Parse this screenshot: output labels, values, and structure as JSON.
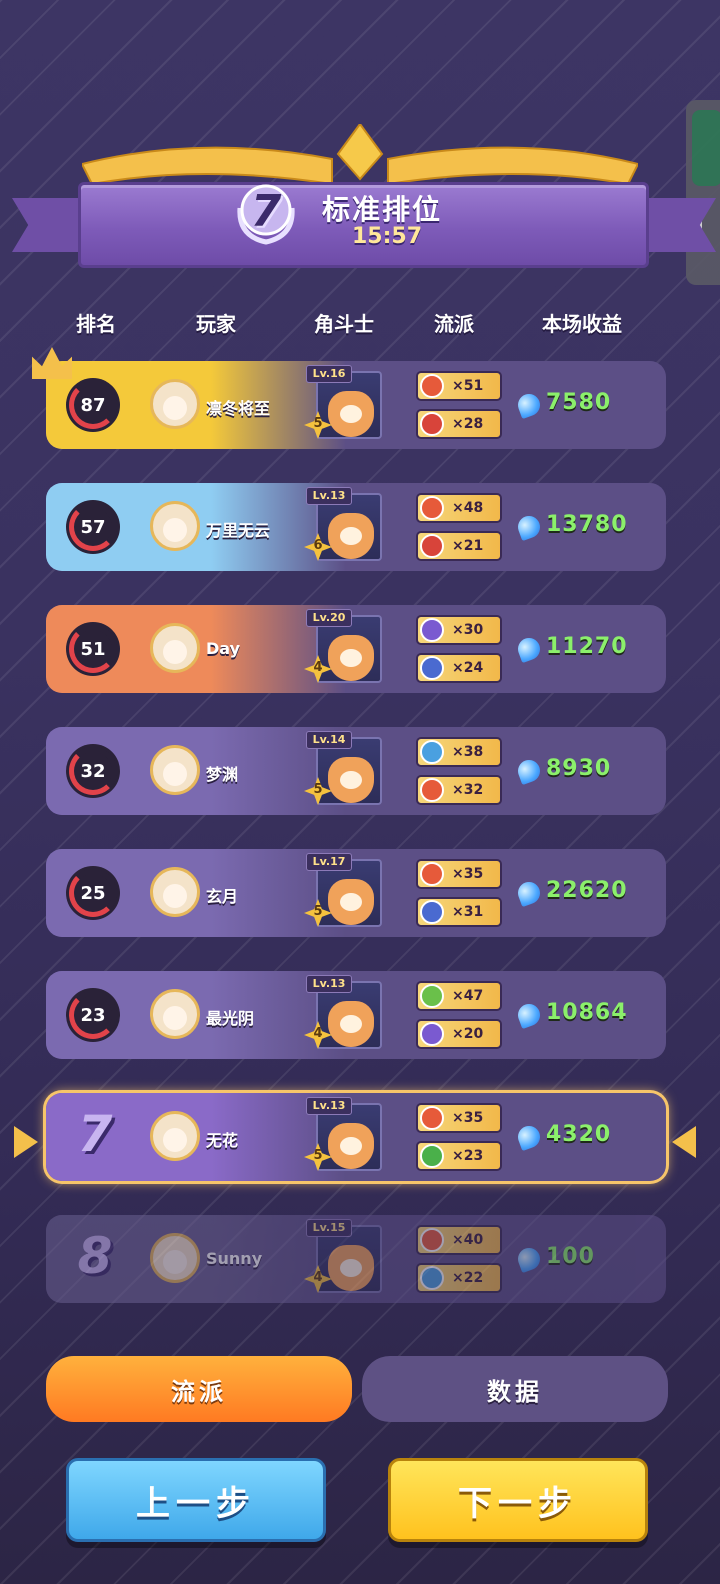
{
  "header": {
    "rank": "7",
    "mode_title": "标准排位",
    "time": "15:57"
  },
  "columns": {
    "rank": "排名",
    "player": "玩家",
    "hero": "角斗士",
    "style": "流派",
    "income": "本场收益"
  },
  "rows": [
    {
      "rank_value": "87",
      "name": "凛冬将至",
      "level": "Lv.16",
      "stars": "5",
      "styles": [
        {
          "icon": "fire-icon",
          "color": "#e65a3a",
          "count": "×51"
        },
        {
          "icon": "flame-icon",
          "color": "#d8443a",
          "count": "×28"
        }
      ],
      "income": "7580",
      "accent": "#f4c93a"
    },
    {
      "rank_value": "57",
      "name": "万里无云",
      "level": "Lv.13",
      "stars": "6",
      "styles": [
        {
          "icon": "fire-icon",
          "color": "#e65a3a",
          "count": "×48"
        },
        {
          "icon": "flame-icon",
          "color": "#d8443a",
          "count": "×21"
        }
      ],
      "income": "13780",
      "accent": "#8fcdf2"
    },
    {
      "rank_value": "51",
      "name": "Day",
      "level": "Lv.20",
      "stars": "4",
      "styles": [
        {
          "icon": "swirl-icon",
          "color": "#7a5ad0",
          "count": "×30"
        },
        {
          "icon": "wind-icon",
          "color": "#4a6ad0",
          "count": "×24"
        }
      ],
      "income": "11270",
      "accent": "#ee8a5a"
    },
    {
      "rank_value": "32",
      "name": "梦渊",
      "level": "Lv.14",
      "stars": "5",
      "styles": [
        {
          "icon": "water-icon",
          "color": "#4aa0e0",
          "count": "×38"
        },
        {
          "icon": "fire-icon",
          "color": "#e65a3a",
          "count": "×32"
        }
      ],
      "income": "8930",
      "accent": "#7b6ab0"
    },
    {
      "rank_value": "25",
      "name": "玄月",
      "level": "Lv.17",
      "stars": "5",
      "styles": [
        {
          "icon": "fire-icon",
          "color": "#e65a3a",
          "count": "×35"
        },
        {
          "icon": "wind-icon",
          "color": "#4a6ad0",
          "count": "×31"
        }
      ],
      "income": "22620",
      "accent": "#7b6ab0"
    },
    {
      "rank_value": "23",
      "name": "最光阴",
      "level": "Lv.13",
      "stars": "4",
      "styles": [
        {
          "icon": "heal-icon",
          "color": "#6ac04a",
          "count": "×47"
        },
        {
          "icon": "swirl-icon",
          "color": "#7a5ad0",
          "count": "×20"
        }
      ],
      "income": "10864",
      "accent": "#7b6ab0"
    },
    {
      "rank_value": "7",
      "name": "无花",
      "level": "Lv.13",
      "stars": "5",
      "styles": [
        {
          "icon": "fire-icon",
          "color": "#e65a3a",
          "count": "×35"
        },
        {
          "icon": "potion-icon",
          "color": "#4ab04a",
          "count": "×23"
        }
      ],
      "income": "4320",
      "accent": "#8a6ac8"
    },
    {
      "rank_value": "8",
      "name": "Sunny",
      "level": "Lv.15",
      "stars": "4",
      "styles": [
        {
          "icon": "fire-icon",
          "color": "#e65a3a",
          "count": "×40"
        },
        {
          "icon": "water-icon",
          "color": "#4aa0e0",
          "count": "×22"
        }
      ],
      "income": "100",
      "accent": "#6a6090"
    }
  ],
  "tabs": {
    "style": "流派",
    "data": "数据"
  },
  "buttons": {
    "prev": "上一步",
    "next": "下一步"
  }
}
